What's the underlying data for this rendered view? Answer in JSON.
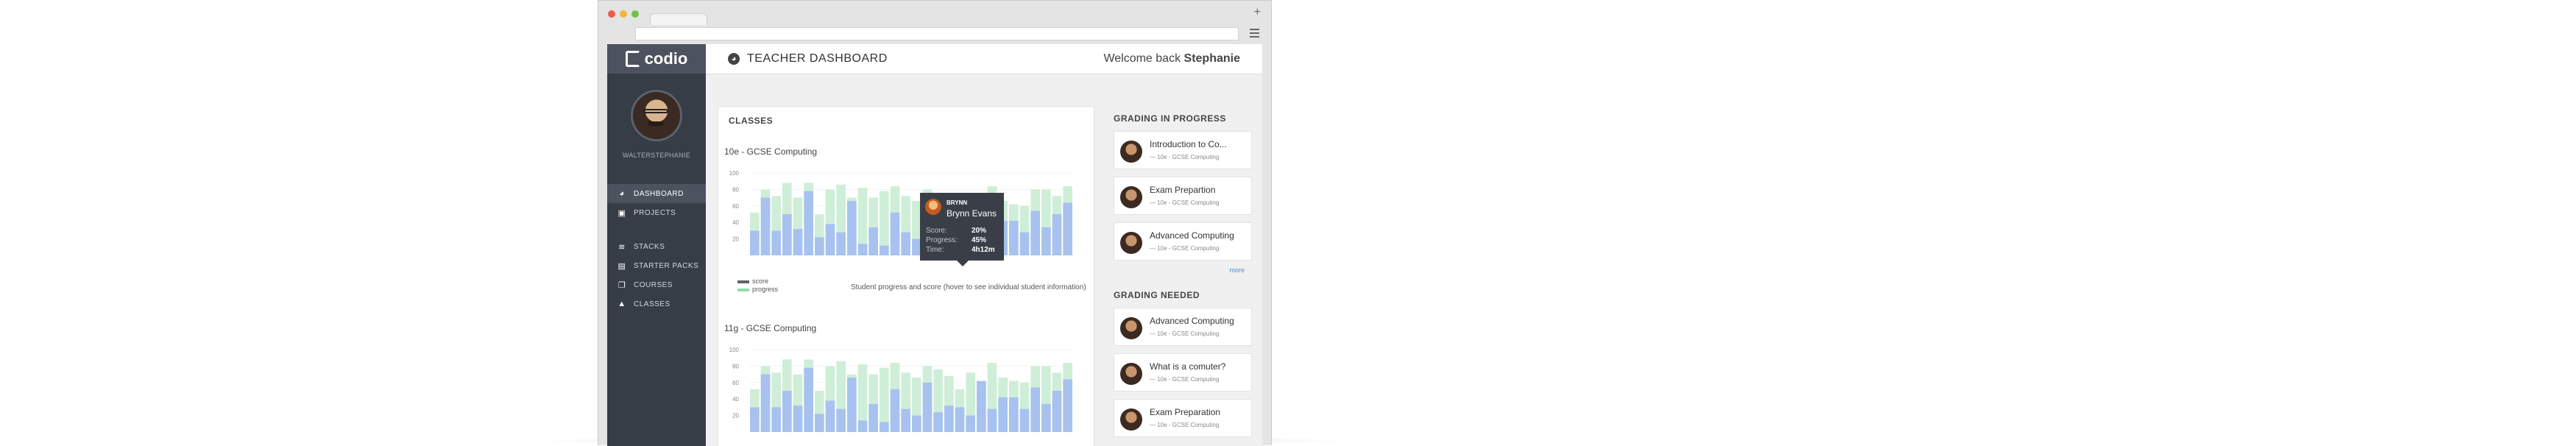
{
  "app": {
    "title": "TEACHER DASHBOARD",
    "welcome_prefix": "Welcome back",
    "welcome_name": "Stephanie",
    "logo_text": "codio",
    "username": "WALTERSTEPHANIE"
  },
  "nav": {
    "dashboard": "DASHBOARD",
    "projects": "PROJECTS",
    "stacks": "STACKS",
    "starter_packs": "STARTER PACKS",
    "courses": "COURSES",
    "classes": "CLASSES"
  },
  "classes_panel": {
    "heading": "CLASSES",
    "class1": "10e - GCSE Computing",
    "class2": "11g - GCSE Computing",
    "legend_score": "score",
    "legend_progress": "progress",
    "note": "Student progress and score (hover to see individual student information)"
  },
  "tooltip": {
    "username": "BRYNN",
    "name": "Brynn Evans",
    "score_label": "Score:",
    "score": "20%",
    "progress_label": "Progress:",
    "progress": "45%",
    "time_label": "Time:",
    "time": "4h12m"
  },
  "grading_in_progress": {
    "heading": "GRADING IN PROGRESS",
    "items": [
      {
        "title": "Introduction to Co...",
        "sub": "— 10e - GCSE Computing"
      },
      {
        "title": "Exam Prepartion",
        "sub": "— 10e - GCSE Computing"
      },
      {
        "title": "Advanced Computing",
        "sub": "— 10e - GCSE Computing"
      }
    ],
    "more": "more"
  },
  "grading_needed": {
    "heading": "GRADING NEEDED",
    "items": [
      {
        "title": "Advanced Computing",
        "sub": "— 10e - GCSE Computing"
      },
      {
        "title": "What is a comuter?",
        "sub": "— 10e - GCSE Computing"
      },
      {
        "title": "Exam Preparation",
        "sub": "— 10e - GCSE Computing"
      }
    ]
  },
  "colors": {
    "progress": "#cfeed8",
    "score": "#a7c2ee",
    "sidebar": "#373d47",
    "legend_score": "#5d6670",
    "legend_progress": "#8fdca7"
  },
  "chart_data": [
    {
      "type": "bar",
      "title": "10e - GCSE Computing",
      "ylim": [
        0,
        100
      ],
      "yticks": [
        100,
        80,
        60,
        40,
        20
      ],
      "series": [
        {
          "name": "progress",
          "values": [
            52,
            80,
            72,
            88,
            70,
            88,
            50,
            80,
            86,
            70,
            82,
            70,
            78,
            84,
            72,
            66,
            80,
            76,
            68,
            52,
            72,
            62,
            84,
            66,
            62,
            60,
            80,
            80,
            72,
            84
          ]
        },
        {
          "name": "score",
          "values": [
            30,
            70,
            30,
            50,
            32,
            78,
            22,
            38,
            28,
            66,
            14,
            34,
            12,
            52,
            28,
            20,
            60,
            24,
            32,
            30,
            20,
            62,
            28,
            42,
            42,
            28,
            54,
            34,
            50,
            64
          ]
        }
      ]
    },
    {
      "type": "bar",
      "title": "11g - GCSE Computing",
      "ylim": [
        0,
        100
      ],
      "yticks": [
        100,
        80,
        60,
        40,
        20
      ],
      "series": [
        {
          "name": "progress",
          "values": [
            52,
            80,
            72,
            88,
            70,
            88,
            50,
            80,
            86,
            70,
            82,
            70,
            78,
            84,
            72,
            66,
            80,
            76,
            68,
            52,
            72,
            62,
            84,
            66,
            62,
            60,
            80,
            80,
            72,
            84
          ]
        },
        {
          "name": "score",
          "values": [
            30,
            70,
            30,
            50,
            32,
            78,
            22,
            38,
            28,
            66,
            14,
            34,
            12,
            52,
            28,
            20,
            60,
            24,
            32,
            30,
            20,
            62,
            28,
            42,
            42,
            28,
            54,
            34,
            50,
            64
          ]
        }
      ]
    }
  ]
}
